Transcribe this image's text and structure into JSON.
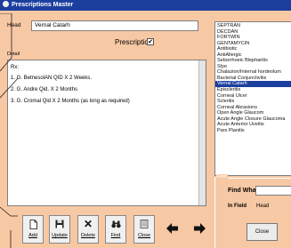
{
  "window": {
    "title": "Prescriptions Master"
  },
  "head": {
    "label": "Head",
    "value": "Vernal Catarh"
  },
  "prescription": {
    "label": "Prescription",
    "checked": true,
    "check_glyph": "✔"
  },
  "detail": {
    "label": "Detail",
    "lines": [
      "Rx:",
      "1. G. BetnesolAN QID X 2 Weeks.",
      "2. G. Andre Qid. X 2 Months",
      "3. G. Cromal Qid X 2 Months (as long as required)"
    ]
  },
  "conditions": {
    "items": [
      "SEPTRAN",
      "DECDAN",
      "FORTWIN",
      "GENTAMYCIN",
      "Antibiotic",
      "AntiAllergic",
      "Seborrhoeic Blepharitis",
      "Stye",
      "Chalazion/Internal hordeolum",
      "Bacterial Conjunctivitis",
      "Vernal Catarh",
      "Episcleritis",
      "Corneal Ulcer",
      "Scleritis",
      "Corneal Abrasions",
      "Open Angle Glaucom",
      "Acute Angle Closure Glaucoma",
      "Acute Anterior Uveitis",
      "Pars Planitis"
    ],
    "selected": "Vernal Catarh"
  },
  "find": {
    "group_label": "Find",
    "what_label": "Find What",
    "in_field_label": "In Field",
    "in_field_value": "Head",
    "close_label": "Close"
  },
  "toolbar": {
    "add": "Add",
    "update": "Update",
    "delete": "Delete",
    "find": "Find",
    "close": "Close"
  }
}
